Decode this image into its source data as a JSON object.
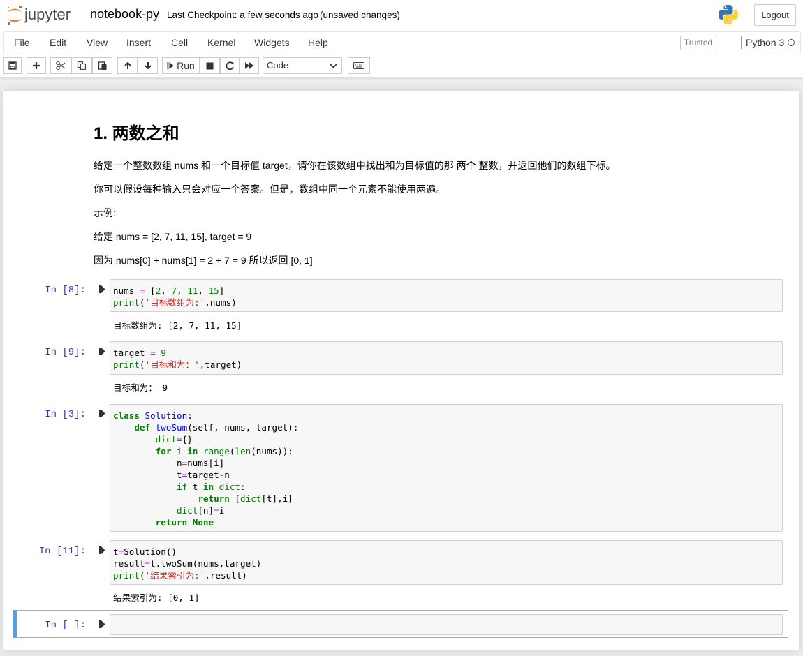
{
  "header": {
    "logo_text": "jupyter",
    "notebook_name": "notebook-py",
    "checkpoint": "Last Checkpoint: a few seconds ago",
    "autosave": "(unsaved changes)",
    "logout_label": "Logout"
  },
  "menubar": {
    "items": [
      "File",
      "Edit",
      "View",
      "Insert",
      "Cell",
      "Kernel",
      "Widgets",
      "Help"
    ],
    "trusted_label": "Trusted",
    "kernel_name": "Python 3"
  },
  "toolbar": {
    "icons": [
      "save-icon",
      "plus-icon",
      "cut-icon",
      "copy-icon",
      "paste-icon",
      "arrow-up-icon",
      "arrow-down-icon",
      "play-icon",
      "stop-icon",
      "restart-icon",
      "fast-forward-icon",
      "keyboard-icon"
    ],
    "run_label": "Run",
    "cell_type": "Code"
  },
  "markdown": {
    "heading": "1. 两数之和",
    "p1": "给定一个整数数组 nums 和一个目标值 target，请你在该数组中找出和为目标值的那 两个 整数，并返回他们的数组下标。",
    "p2": "你可以假设每种输入只会对应一个答案。但是，数组中同一个元素不能使用两遍。",
    "p3": "示例:",
    "p4": "给定 nums = [2, 7, 11, 15], target = 9",
    "p5": "因为 nums[0] + nums[1] = 2 + 7 = 9 所以返回 [0, 1]"
  },
  "cells": [
    {
      "prompt": "In [8]:",
      "code": "nums = [2, 7, 11, 15]\nprint('目标数组为:',nums)",
      "output": "目标数组为: [2, 7, 11, 15]"
    },
    {
      "prompt": "In [9]:",
      "code": "target = 9\nprint('目标和为：',target)",
      "output": "目标和为： 9"
    },
    {
      "prompt": "In [3]:",
      "code": "class Solution:\n    def twoSum(self, nums, target):\n        dict={}\n        for i in range(len(nums)):\n            n=nums[i]\n            t=target-n\n            if t in dict:\n                return [dict[t],i]\n            dict[n]=i\n        return None",
      "output": ""
    },
    {
      "prompt": "In [11]:",
      "code": "t=Solution()\nresult=t.twoSum(nums,target)\nprint('结果索引为:',result)",
      "output": "结果索引为: [0, 1]"
    },
    {
      "prompt": "In [ ]:",
      "code": "",
      "output": ""
    }
  ],
  "colors": {
    "prompt": "#303f9f",
    "selected_cell_border": "#42a5f5",
    "jupyter_orange": "#f37726"
  }
}
